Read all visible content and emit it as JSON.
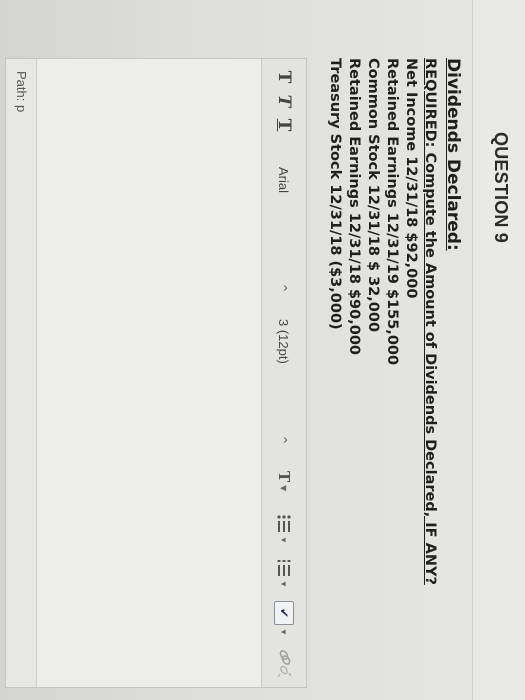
{
  "question": {
    "label": "QUESTION 9",
    "heading": "Dividends Declared:",
    "required": "REQUIRED: Compute the Amount of Dividends Declared, IF ANY?",
    "lines": [
      "Net Income 12/31/18 $92,000",
      "Retained Earnings 12/31/19 $155,000",
      "Common Stock 12/31/18 $ 32,000",
      "Retained Earnings 12/31/18 $90,000",
      "Treasury Stock 12/31/18 ($3,000)"
    ]
  },
  "toolbar": {
    "bold_glyph": "T",
    "italic_glyph": "T",
    "underline_glyph": "T",
    "font_value": "Arial",
    "size_value": "3 (12pt)",
    "text_color_glyph": "T"
  },
  "statusbar": {
    "path": "Path: p"
  },
  "icons": {
    "bold": "bold-icon",
    "italic": "italic-icon",
    "underline": "underline-icon",
    "text_color": "text-color-icon",
    "bullet_list": "bullet-list-icon",
    "number_list": "numbered-list-icon",
    "spellcheck": "spellcheck-icon",
    "link": "link-icon"
  }
}
